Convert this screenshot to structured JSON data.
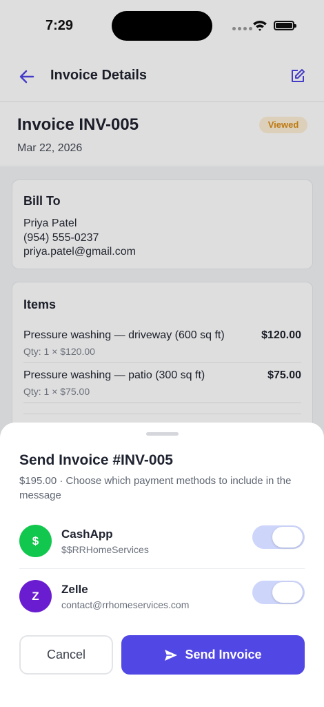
{
  "status_bar": {
    "time": "7:29"
  },
  "nav": {
    "title": "Invoice Details",
    "back_icon": "arrow-left-icon",
    "edit_icon": "edit-icon"
  },
  "invoice": {
    "title": "Invoice INV-005",
    "date": "Mar 22, 2026",
    "status": "Viewed"
  },
  "bill_to": {
    "heading": "Bill To",
    "name": "Priya Patel",
    "phone": "(954) 555-0237",
    "email": "priya.patel@gmail.com"
  },
  "items": {
    "heading": "Items",
    "rows": [
      {
        "name": "Pressure washing — driveway (600 sq ft)",
        "qty": "Qty: 1 × $120.00",
        "price": "$120.00"
      },
      {
        "name": "Pressure washing — patio (300 sq ft)",
        "qty": "Qty: 1 × $75.00",
        "price": "$75.00"
      }
    ]
  },
  "sheet": {
    "title": "Send Invoice #INV-005",
    "subtitle": "$195.00 · Choose which payment methods to include in the message",
    "methods": [
      {
        "initial": "$",
        "name": "CashApp",
        "handle": "$$RRHomeServices",
        "enabled": true,
        "color": "#12c74d"
      },
      {
        "initial": "Z",
        "name": "Zelle",
        "handle": "contact@rrhomeservices.com",
        "enabled": true,
        "color": "#6a1dd0"
      }
    ],
    "cancel_label": "Cancel",
    "send_label": "Send Invoice",
    "send_icon": "send-icon"
  },
  "colors": {
    "accent": "#5147e5",
    "badge_bg": "#fdefd6",
    "badge_text": "#d98c14",
    "toggle_on": "#cdd5fb"
  }
}
